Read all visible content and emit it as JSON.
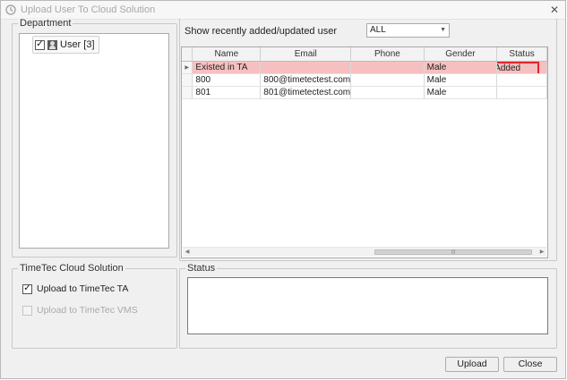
{
  "window": {
    "title": "Upload User To Cloud Solution",
    "close_glyph": "✕"
  },
  "department": {
    "group_title": "Department",
    "tree": {
      "checked": true,
      "label": "User [3]"
    }
  },
  "filter": {
    "label": "Show recently added/updated user",
    "selected": "ALL"
  },
  "grid": {
    "columns": [
      "Name",
      "Email",
      "Phone",
      "Gender",
      "Status"
    ],
    "rows": [
      {
        "name": "Existed in TA",
        "email": "",
        "phone": "",
        "gender": "Male",
        "status": "Added",
        "selected": true
      },
      {
        "name": "800",
        "email": "800@timetectest.com",
        "phone": "",
        "gender": "Male",
        "status": "",
        "selected": false
      },
      {
        "name": "801",
        "email": "801@timetectest.com",
        "phone": "",
        "gender": "Male",
        "status": "",
        "selected": false
      }
    ]
  },
  "cloud": {
    "group_title": "TimeTec Cloud Solution",
    "options": [
      {
        "label": "Upload to TimeTec TA",
        "checked": true,
        "enabled": true
      },
      {
        "label": "Upload to TimeTec VMS",
        "checked": false,
        "enabled": false
      }
    ]
  },
  "status_panel": {
    "group_title": "Status",
    "text": ""
  },
  "buttons": {
    "upload": "Upload",
    "close": "Close"
  },
  "colors": {
    "selected_row": "#f7c0c0",
    "status_highlight": "#e0282b"
  }
}
